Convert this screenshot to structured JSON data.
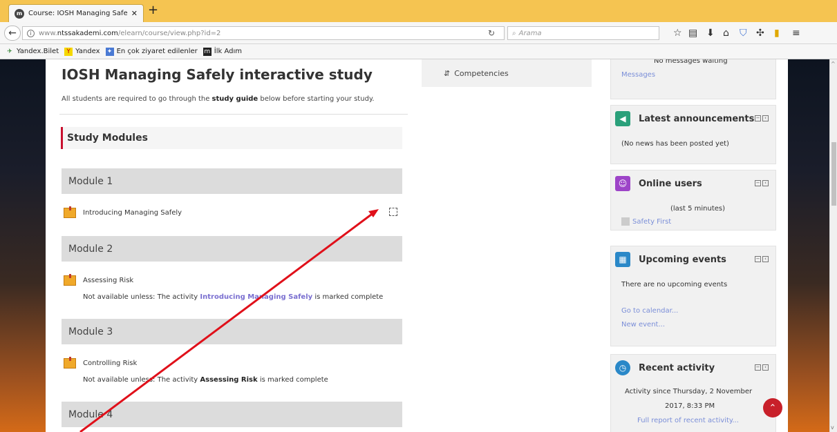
{
  "browser": {
    "tab_title": "Course: IOSH Managing Safe",
    "url_prefix": "www.",
    "url_domain": "ntssakademi.com",
    "url_path": "/elearn/course/view.php?id=2",
    "search_placeholder": "Arama",
    "bookmarks": [
      "Yandex.Bilet",
      "Yandex",
      "En çok ziyaret edilenler",
      "İlk Adım"
    ]
  },
  "course": {
    "title": "IOSH Managing Safely interactive study",
    "intro_before": "All students are required to go through the ",
    "intro_bold": "study guide",
    "intro_after": " below before starting your study.",
    "section_title": "Study Modules",
    "modules": [
      {
        "name": "Module 1",
        "activity": "Introducing Managing Safely"
      },
      {
        "name": "Module 2",
        "activity": "Assessing Risk",
        "cond_before": "Not available unless: The activity ",
        "cond_link": "Introducing Managing Safely",
        "cond_after": " is marked complete"
      },
      {
        "name": "Module 3",
        "activity": "Controlling Risk",
        "cond_before": "Not available unless: The activity ",
        "cond_link": "Assessing Risk",
        "cond_after": " is marked complete"
      },
      {
        "name": "Module 4"
      }
    ]
  },
  "nav": {
    "competencies": "Competencies"
  },
  "blocks": {
    "messages": {
      "text": "No messages waiting",
      "link": "Messages"
    },
    "announcements": {
      "title": "Latest announcements",
      "text": "(No news has been posted yet)"
    },
    "online": {
      "title": "Online users",
      "text": "(last 5 minutes)",
      "user": "Safety First"
    },
    "events": {
      "title": "Upcoming events",
      "text": "There are no upcoming events",
      "link1": "Go to calendar...",
      "link2": "New event..."
    },
    "recent": {
      "title": "Recent activity",
      "text1": "Activity since Thursday, 2 November",
      "text2": "2017, 8:33 PM",
      "link": "Full report of recent activity..."
    }
  },
  "colors": {
    "accent_red": "#c8102e",
    "link": "#7a8ed8",
    "tab_bar": "#f5c451"
  },
  "icons": [
    "moodle-favicon",
    "back-arrow-icon",
    "info-icon",
    "reload-icon",
    "search-icon",
    "star-icon",
    "bookmark-list-icon",
    "download-icon",
    "home-icon",
    "shield-icon",
    "puzzle-icon",
    "flag-icon",
    "menu-icon",
    "package-icon",
    "megaphone-icon",
    "users-icon",
    "calendar-icon",
    "clock-icon",
    "scroll-top-icon"
  ]
}
